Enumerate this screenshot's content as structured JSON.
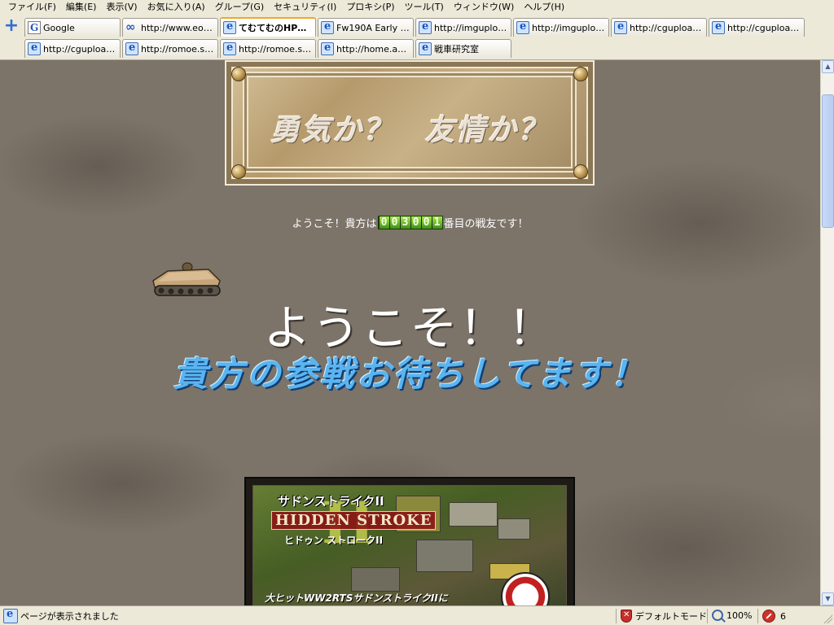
{
  "menu": [
    "ファイル(F)",
    "編集(E)",
    "表示(V)",
    "お気に入り(A)",
    "グループ(G)",
    "セキュリティ(I)",
    "プロキシ(P)",
    "ツール(T)",
    "ウィンドウ(W)",
    "ヘルプ(H)"
  ],
  "tabs": [
    {
      "label": "Google",
      "icon": "google-icon"
    },
    {
      "label": "http://www.eone...",
      "icon": "loop-icon"
    },
    {
      "label": "てむてむのHPです...",
      "icon": "ie-page-icon",
      "active": true
    },
    {
      "label": "Fw190A Early T...",
      "icon": "ie-page-icon"
    },
    {
      "label": "http://imgupload...",
      "icon": "ie-page-icon"
    },
    {
      "label": "http://imgupload...",
      "icon": "ie-page-icon"
    },
    {
      "label": "http://cgupload...",
      "icon": "ie-page-icon"
    },
    {
      "label": "http://cgupload...",
      "icon": "ie-page-icon"
    },
    {
      "label": "http://cgupload...",
      "icon": "ie-page-icon"
    },
    {
      "label": "http://romoe.s4...",
      "icon": "ie-page-icon"
    },
    {
      "label": "http://romoe.s4...",
      "icon": "ie-page-icon"
    },
    {
      "label": "http://home.att.n...",
      "icon": "ie-page-icon"
    },
    {
      "label": "戦車研究室",
      "icon": "ie-page-icon"
    }
  ],
  "page": {
    "banner_text": "勇気か？　友情か？",
    "counter_prefix": "ようこそ！貴方は",
    "counter_digits": [
      "0",
      "0",
      "3",
      "0",
      "0",
      "1"
    ],
    "counter_suffix": "番目の戦友です！",
    "welcome": "ようこそ！！",
    "invite": "貴方の参戦お待ちしてます！",
    "game": {
      "title_jp": "サドンストライクII",
      "title_en": "HIDDEN STROKE",
      "title_jp2": "ヒドゥン ストロークII",
      "numeral": "II",
      "caption": "大ヒットWW2RTSサドンストライクIIに"
    }
  },
  "status": {
    "text": "ページが表示されました",
    "mode": "デフォルトモード",
    "zoom": "100%",
    "blocked_count": "6"
  },
  "colors": {
    "page_background": "#7c7369",
    "invite_text": "#5ab4f0",
    "counter_digit": "#6fc02c",
    "active_tab_accent": "#f5a623"
  }
}
